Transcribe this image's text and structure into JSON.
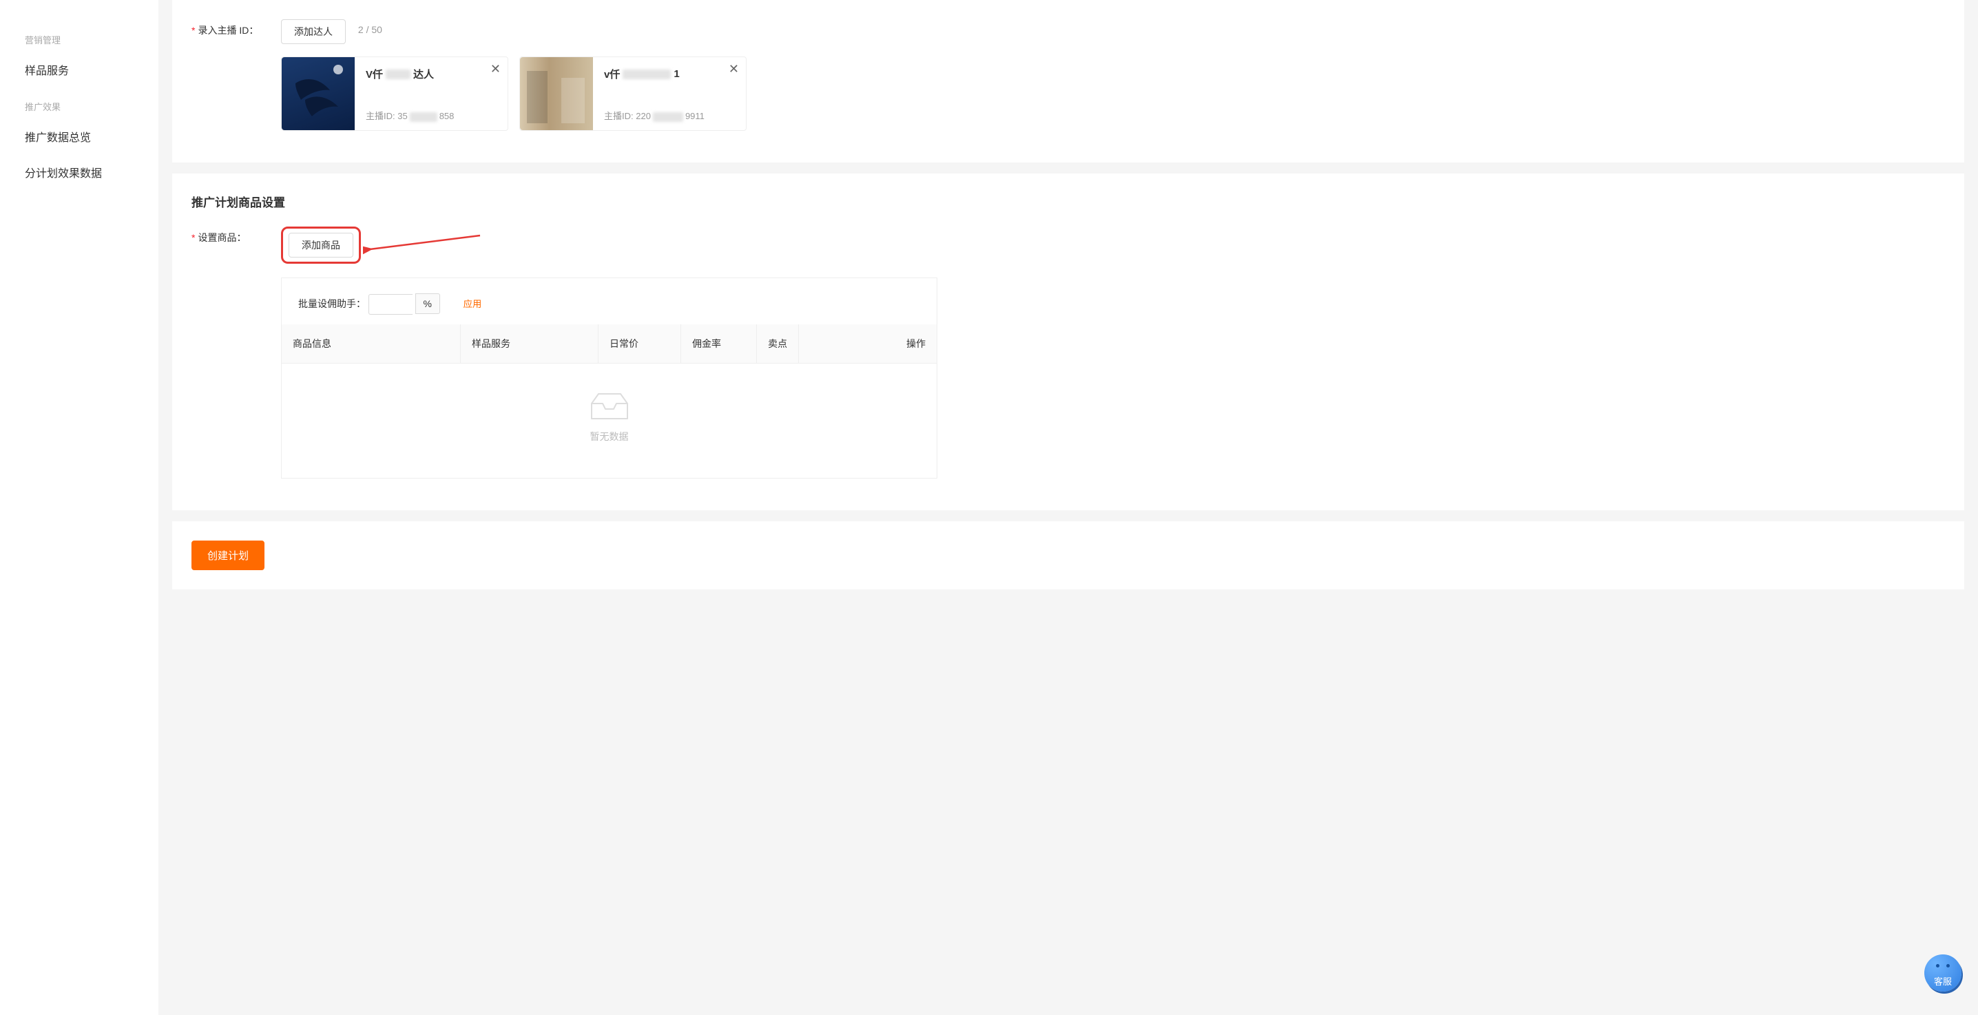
{
  "sidebar": {
    "section1_title": "营销管理",
    "item_sample": "样品服务",
    "section2_title": "推广效果",
    "item_overview": "推广数据总览",
    "item_plan_detail": "分计划效果数据"
  },
  "anchor": {
    "label": "录入主播 ID：",
    "add_btn": "添加达人",
    "count": "2 / 50",
    "cards": [
      {
        "name_prefix": "V仟",
        "name_suffix": "达人",
        "id_label": "主播ID: ",
        "id_prefix": "35",
        "id_suffix": "858"
      },
      {
        "name_prefix": "v仟",
        "name_suffix": "1",
        "id_label": "主播ID: ",
        "id_prefix": "220",
        "id_suffix": "9911"
      }
    ]
  },
  "product": {
    "section_title": "推广计划商品设置",
    "set_label": "设置商品：",
    "add_btn": "添加商品",
    "helper_label": "批量设佣助手：",
    "pct": "%",
    "apply": "应用",
    "headers": {
      "info": "商品信息",
      "sample": "样品服务",
      "price": "日常价",
      "rate": "佣金率",
      "point": "卖点",
      "op": "操作"
    },
    "empty": "暂无数据"
  },
  "footer": {
    "create_btn": "创建计划"
  },
  "fab": {
    "label": "客服"
  }
}
